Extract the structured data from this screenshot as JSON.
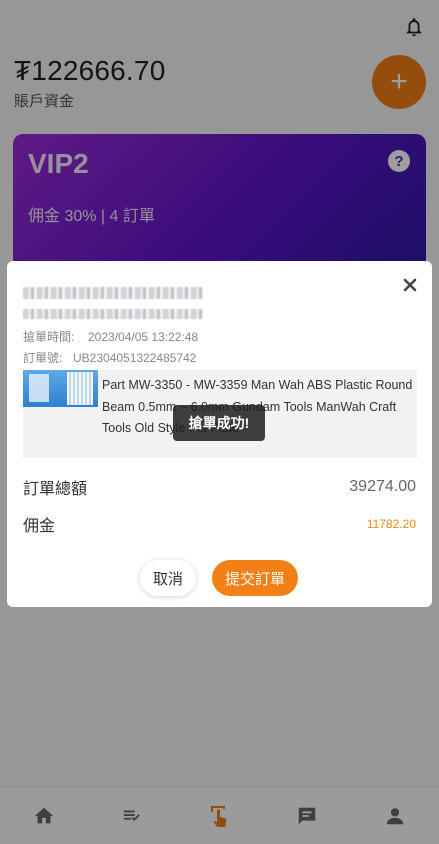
{
  "header": {
    "balance": "₮122666.70",
    "balance_label": "賬戶資金"
  },
  "vip": {
    "title": "VIP2",
    "subtitle": "佣金 30% | 4 訂單",
    "help_symbol": "?"
  },
  "modal": {
    "grab_time_label": "搶單時間:",
    "grab_time_value": "2023/04/05 13:22:48",
    "order_no_label": "訂單號:",
    "order_no_value": "UB2304051322485742",
    "product_name": "Part MW-3350 - MW-3359 Man Wah ABS Plastic Round Beam 0.5mm ~ 6.0mm Gundam Tools ManWah Craft Tools Old Style Pla Plate",
    "toast": "搶單成功!",
    "total_label": "訂單總額",
    "total_value": "39274.00",
    "commission_label": "佣金",
    "commission_value": "11782.20",
    "cancel_label": "取消",
    "submit_label": "提交訂單"
  },
  "icons": {
    "add": "add-icon",
    "bell": "bell-icon",
    "close": "close-icon",
    "home": "home-icon",
    "orders": "list-check-icon",
    "grab": "tap-hand-icon",
    "messages": "message-icon",
    "profile": "user-icon"
  },
  "colors": {
    "accent": "#f07c17",
    "vip_gradient_start": "#9a2bd6",
    "vip_gradient_end": "#2a1aa0",
    "commission": "#f08a1c"
  }
}
